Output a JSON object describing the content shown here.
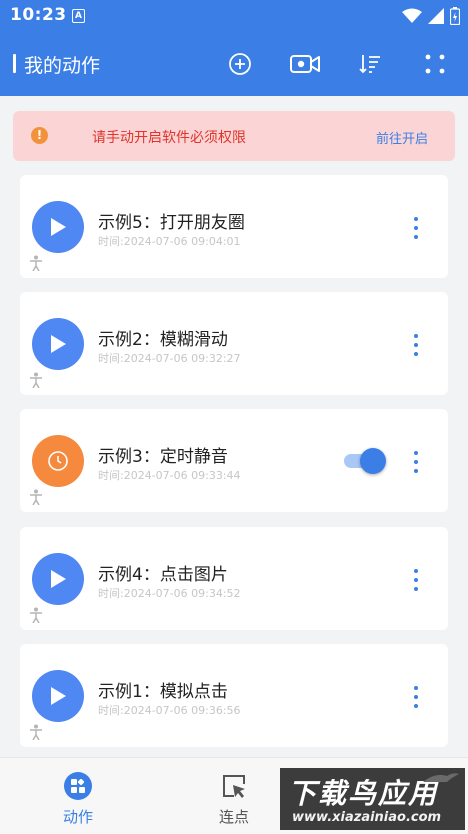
{
  "status_bar": {
    "time": "10:23",
    "notification_icon": "A"
  },
  "top_bar": {
    "title": "我的动作",
    "icons": [
      "add-icon",
      "record-video-icon",
      "sort-icon",
      "fullscreen-icon"
    ]
  },
  "permission_banner": {
    "message": "请手动开启软件必须权限",
    "action_label": "前往开启",
    "icon": "!"
  },
  "actions": [
    {
      "title": "示例5：打开朋友圈",
      "time": "时间:2024-07-06 09:04:01",
      "type": "play",
      "color": "#4f88f2"
    },
    {
      "title": "示例2：模糊滑动",
      "time": "时间:2024-07-06 09:32:27",
      "type": "play",
      "color": "#4f88f2"
    },
    {
      "title": "示例3：定时静音",
      "time": "时间:2024-07-06 09:33:44",
      "type": "timer",
      "color": "#f5893d",
      "toggle_on": true
    },
    {
      "title": "示例4：点击图片",
      "time": "时间:2024-07-06 09:34:52",
      "type": "play",
      "color": "#4f88f2"
    },
    {
      "title": "示例1：模拟点击",
      "time": "时间:2024-07-06 09:36:56",
      "type": "play",
      "color": "#4f88f2"
    }
  ],
  "bottom_nav": {
    "items": [
      {
        "label": "动作",
        "active": true
      },
      {
        "label": "连点",
        "active": false
      }
    ]
  },
  "watermark": {
    "title": "下载鸟应用",
    "url": "www.xiazainiao.com"
  },
  "colors": {
    "primary": "#3a7ee6",
    "banner_bg": "#fbd5d5",
    "banner_text": "#e0342c",
    "orange": "#f5893d"
  }
}
